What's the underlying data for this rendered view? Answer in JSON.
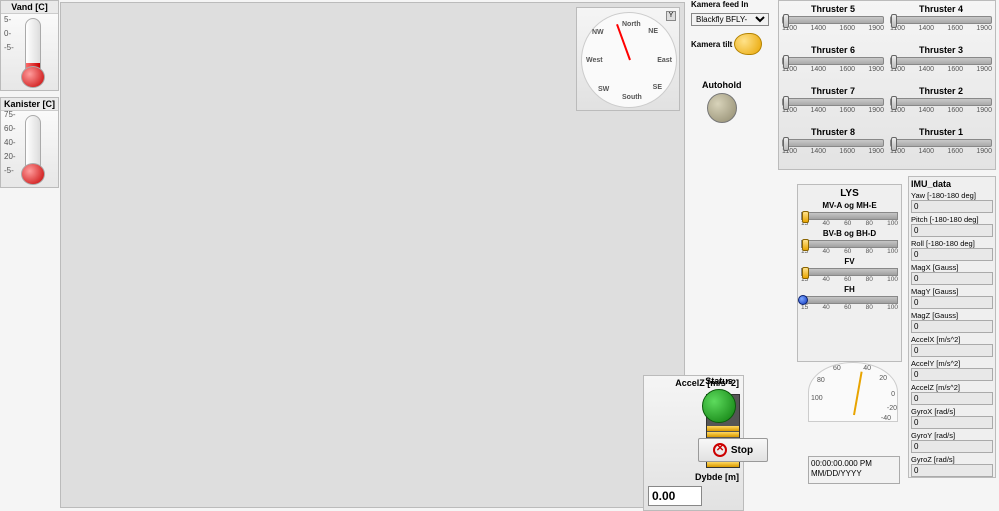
{
  "thermo": {
    "vand": {
      "title": "Vand [C]",
      "scale": [
        "5-",
        "0-",
        "-5-"
      ],
      "fill_pct": 18
    },
    "kanister": {
      "title": "Kanister [C]",
      "scale": [
        "75-",
        "60-",
        "40-",
        "20-",
        "-5-"
      ],
      "fill_pct": 8
    }
  },
  "compass": {
    "labels": {
      "N": "North",
      "NE": "NE",
      "E": "East",
      "SE": "SE",
      "S": "South",
      "SW": "SW",
      "W": "West",
      "NW": "NW"
    }
  },
  "kamera": {
    "label": "Kamera feed In",
    "select_value": "Blackfly BFLY-",
    "tilt_label": "Kamera tilt"
  },
  "autohold": {
    "label": "Autohold"
  },
  "thruster_panel": {
    "ticks": [
      "1100",
      "1400",
      "1600",
      "1900"
    ],
    "cells": [
      {
        "name": "Thruster 5"
      },
      {
        "name": "Thruster 4"
      },
      {
        "name": "Thruster 6"
      },
      {
        "name": "Thruster 3"
      },
      {
        "name": "Thruster 7"
      },
      {
        "name": "Thruster 2"
      },
      {
        "name": "Thruster 8"
      },
      {
        "name": "Thruster 1"
      }
    ]
  },
  "lys": {
    "title": "LYS",
    "ticks": [
      "15",
      "40",
      "60",
      "80",
      "100"
    ],
    "rows": [
      {
        "label": "MV-A og MH-E",
        "thumb": "y"
      },
      {
        "label": "BV-B og BH-D",
        "thumb": "y"
      },
      {
        "label": "FV",
        "thumb": "y"
      },
      {
        "label": "FH",
        "thumb": "b"
      }
    ]
  },
  "imu": {
    "title": "IMU_data",
    "rows": [
      {
        "label": "Yaw [-180-180 deg]",
        "value": "0"
      },
      {
        "label": "Pitch [-180-180 deg]",
        "value": "0"
      },
      {
        "label": "Roll [-180-180 deg]",
        "value": "0"
      },
      {
        "label": "MagX [Gauss]",
        "value": "0"
      },
      {
        "label": "MagY [Gauss]",
        "value": "0"
      },
      {
        "label": "MagZ [Gauss]",
        "value": "0"
      },
      {
        "label": "AccelX [m/s^2]",
        "value": "0"
      },
      {
        "label": "AccelY [m/s^2]",
        "value": "0"
      },
      {
        "label": "AccelZ [m/s^2]",
        "value": "0"
      },
      {
        "label": "GyroX [rad/s]",
        "value": "0"
      },
      {
        "label": "GyroY [rad/s]",
        "value": "0"
      },
      {
        "label": "GyroZ [rad/s]",
        "value": "0"
      }
    ]
  },
  "gauge": {
    "ticks": [
      "100",
      "80",
      "60",
      "40",
      "20",
      "0",
      "-20",
      "-40"
    ]
  },
  "timestamp": {
    "time": "00:00:00.000 PM",
    "date": "MM/DD/YYYY"
  },
  "status": {
    "label": "Status"
  },
  "stop": {
    "label": "Stop"
  },
  "az_panel": {
    "accel_label": "AccelZ [m/s^2]",
    "depth_label": "Dybde [m]",
    "depth_value": "0.00"
  }
}
